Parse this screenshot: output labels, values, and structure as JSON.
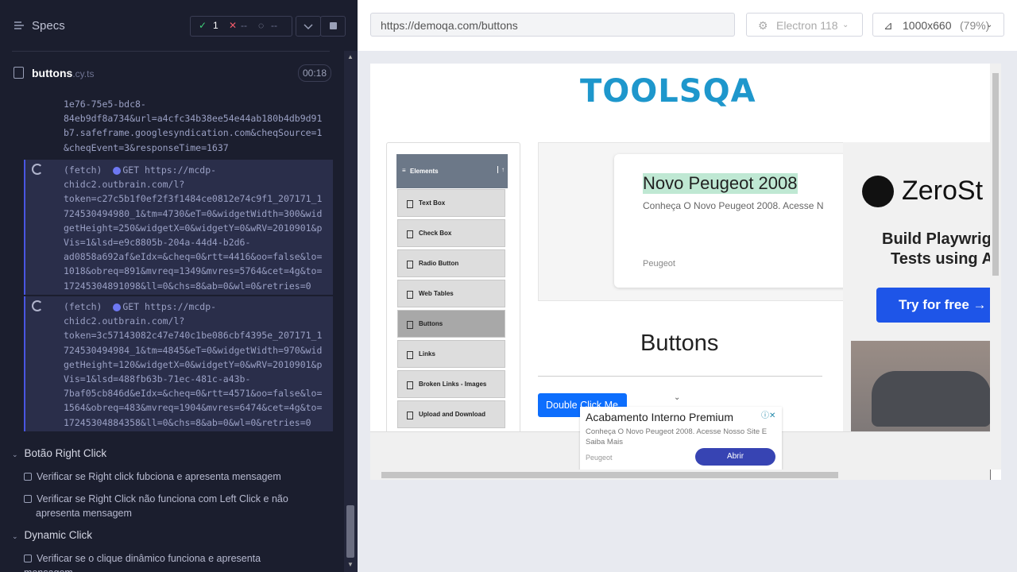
{
  "reporter": {
    "title": "Specs",
    "stats": {
      "passed": "1",
      "failed": "--",
      "pending": "--"
    },
    "spec_file": {
      "name": "buttons",
      "ext": ".cy.ts",
      "duration": "00:18"
    },
    "log_prev": [
      "1e76-75e5-bdc8-",
      "84eb9df8a734&url=a4cfc34b38ee54e44ab180b4db9d91",
      "b7.safeframe.googlesyndication.com&cheqSource=1",
      "&cheqEvent=3&responseTime=1637"
    ],
    "fetch1": {
      "label": "(fetch)",
      "method": "GET",
      "lines": [
        "https://mcdp-",
        "chidc2.outbrain.com/l?",
        "token=c27c5b1f0ef2f3f1484ce0812e74c9f1_207171_1",
        "724530494980_1&tm=4730&eT=0&widgetWidth=300&wid",
        "getHeight=250&widgetX=0&widgetY=0&wRV=2010901&p",
        "Vis=1&lsd=e9c8805b-204a-44d4-b2d6-",
        "ad0858a692af&eIdx=&cheq=0&rtt=4416&oo=false&lo=",
        "1018&obreq=891&mvreq=1349&mvres=5764&cet=4g&to=",
        "17245304891098&ll=0&chs=8&ab=0&wl=0&retries=0"
      ]
    },
    "fetch2": {
      "label": "(fetch)",
      "method": "GET",
      "lines": [
        "https://mcdp-",
        "chidc2.outbrain.com/l?",
        "token=3c57143082c47e740c1be086cbf4395e_207171_1",
        "724530494984_1&tm=4845&eT=0&widgetWidth=970&wid",
        "getHeight=120&widgetX=0&widgetY=0&wRV=2010901&p",
        "Vis=1&lsd=488fb63b-71ec-481c-a43b-",
        "7baf05cb846d&eIdx=&cheq=0&rtt=4571&oo=false&lo=",
        "1564&obreq=483&mvreq=1904&mvres=6474&cet=4g&to=",
        "17245304884358&ll=0&chs=8&ab=0&wl=0&retries=0"
      ]
    },
    "groups": [
      {
        "title": "Botão Right Click",
        "tests": [
          "Verificar se Right click fubciona e apresenta mensagem",
          "Verificar se Right Click não funciona com Left Click e não apresenta mensagem"
        ]
      },
      {
        "title": "Dynamic Click",
        "tests": [
          "Verificar se o clique dinâmico funciona e apresenta mensagem"
        ]
      }
    ]
  },
  "browser": {
    "url": "https://demoqa.com/buttons",
    "name": "Electron 118",
    "viewport": "1000x660",
    "zoom": "(79%)"
  },
  "page": {
    "logo": "TOOLSQA",
    "elements_header": "Elements",
    "menu": [
      "Text Box",
      "Check Box",
      "Radio Button",
      "Web Tables",
      "Buttons",
      "Links",
      "Broken Links - Images",
      "Upload and Download"
    ],
    "ad": {
      "title": "Novo Peugeot 2008",
      "subtitle": "Conheça O Novo Peugeot 2008. Acesse N",
      "brand": "Peugeot"
    },
    "heading": "Buttons",
    "double_click": "Double Click Me",
    "side_ad": {
      "brand": "ZeroSt",
      "line1": "Build Playwrig",
      "line2": "Tests using A",
      "cta": "Try for free →"
    },
    "pop_ad": {
      "title": "Acabamento Interno Premium",
      "text": "Conheça O Novo Peugeot 2008. Acesse Nosso Site E Saiba Mais",
      "brand": "Peugeot",
      "cta": "Abrir"
    }
  }
}
